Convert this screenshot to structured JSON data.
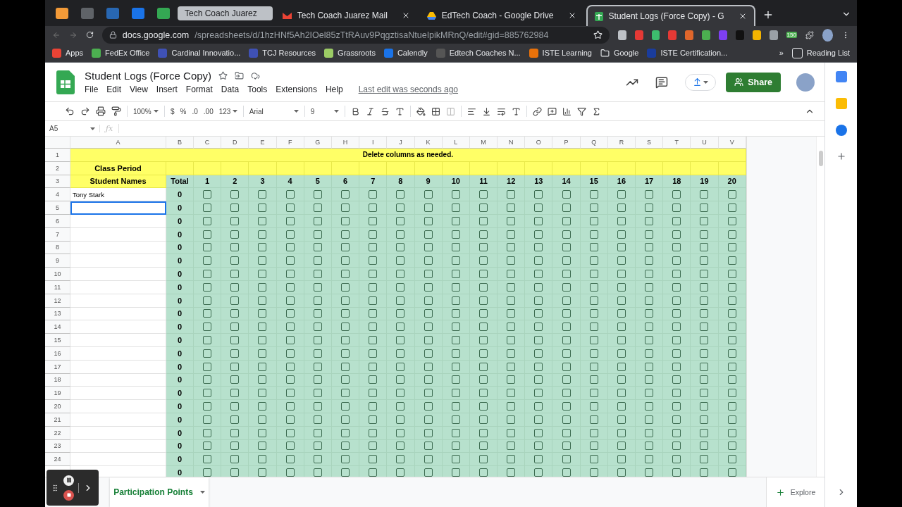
{
  "browser": {
    "tabs": [
      {
        "label": "Tech Coach Juarez",
        "kind": "group",
        "selected": false
      },
      {
        "label": "Tech Coach Juarez Mail",
        "kind": "mail",
        "selected": false
      },
      {
        "label": "EdTech Coach - Google Drive",
        "kind": "drive",
        "selected": false
      },
      {
        "label": "Student Logs (Force Copy) - G",
        "kind": "sheets",
        "selected": true
      }
    ],
    "url_host": "docs.google.com",
    "url_path": "/spreadsheets/d/1hzHNf5Ah2IOel85zTtRAuv9PqgztisaNtueIpikMRnQ/edit#gid=885762984",
    "extension_badge": "150",
    "bookmarks": [
      {
        "label": "Apps",
        "kind": "apps"
      },
      {
        "label": "FedEx Office",
        "kind": "star"
      },
      {
        "label": "Cardinal Innovatio...",
        "kind": "site"
      },
      {
        "label": "TCJ Resources",
        "kind": "site"
      },
      {
        "label": "Grassroots",
        "kind": "leaf"
      },
      {
        "label": "Calendly",
        "kind": "calendly"
      },
      {
        "label": "Edtech Coaches N...",
        "kind": "ring"
      },
      {
        "label": "ISTE Learning",
        "kind": "d2l"
      },
      {
        "label": "Google",
        "kind": "folder"
      },
      {
        "label": "ISTE Certification...",
        "kind": "k"
      }
    ],
    "bookmarks_more": "»",
    "reading_list": "Reading List"
  },
  "doc": {
    "title": "Student Logs (Force Copy)",
    "menu": [
      "File",
      "Edit",
      "View",
      "Insert",
      "Format",
      "Data",
      "Tools",
      "Extensions",
      "Help"
    ],
    "last_edit": "Last edit was seconds ago",
    "share": "Share"
  },
  "toolbar": {
    "zoom": "100%",
    "currency": "$",
    "percent": "%",
    "decimal_decrease": ".0",
    "decimal_increase": ".00",
    "number_format": "123",
    "font": "Arial",
    "font_size": "9"
  },
  "formula_bar": {
    "cell_ref": "A5",
    "fx_label": "ƒx"
  },
  "sheet": {
    "columns": [
      "A",
      "B",
      "C",
      "D",
      "E",
      "F",
      "G",
      "H",
      "I",
      "J",
      "K",
      "L",
      "M",
      "N",
      "O",
      "P",
      "Q",
      "R",
      "S",
      "T",
      "U",
      "V"
    ],
    "header_rows": [
      "1",
      "2",
      "3"
    ],
    "banner": "Delete columns as needed.",
    "class_period": "Class Period",
    "student_names": "Student Names",
    "total_header": "Total",
    "numbers": [
      "1",
      "2",
      "3",
      "4",
      "5",
      "6",
      "7",
      "8",
      "9",
      "10",
      "11",
      "12",
      "13",
      "14",
      "15",
      "16",
      "17",
      "18",
      "19",
      "20"
    ],
    "rows": [
      {
        "number": "4",
        "name": "Tony Stark",
        "total": "0",
        "selected": false,
        "checks": [
          false,
          false,
          false,
          false,
          false,
          false,
          false,
          false,
          false,
          false,
          false,
          false,
          false,
          false,
          false,
          false,
          false,
          false,
          false,
          false
        ]
      },
      {
        "number": "5",
        "total": "0",
        "selected": true,
        "checks": [
          false,
          false,
          false,
          false,
          false,
          false,
          false,
          false,
          false,
          false,
          false,
          false,
          false,
          false,
          false,
          false,
          false,
          false,
          false,
          false
        ]
      },
      {
        "number": "6",
        "total": "0",
        "selected": false,
        "checks": [
          false,
          false,
          false,
          false,
          false,
          false,
          false,
          false,
          false,
          false,
          false,
          false,
          false,
          false,
          false,
          false,
          false,
          false,
          false,
          false
        ]
      },
      {
        "number": "7",
        "total": "0",
        "selected": false,
        "checks": [
          false,
          false,
          false,
          false,
          false,
          false,
          false,
          false,
          false,
          false,
          false,
          false,
          false,
          false,
          false,
          false,
          false,
          false,
          false,
          false
        ]
      },
      {
        "number": "8",
        "total": "0",
        "selected": false,
        "checks": [
          false,
          false,
          false,
          false,
          false,
          false,
          false,
          false,
          false,
          false,
          false,
          false,
          false,
          false,
          false,
          false,
          false,
          false,
          false,
          false
        ]
      },
      {
        "number": "9",
        "total": "0",
        "selected": false,
        "checks": [
          false,
          false,
          false,
          false,
          false,
          false,
          false,
          false,
          false,
          false,
          false,
          false,
          false,
          false,
          false,
          false,
          false,
          false,
          false,
          false
        ]
      },
      {
        "number": "10",
        "total": "0",
        "selected": false,
        "checks": [
          false,
          false,
          false,
          false,
          false,
          false,
          false,
          false,
          false,
          false,
          false,
          false,
          false,
          false,
          false,
          false,
          false,
          false,
          false,
          false
        ]
      },
      {
        "number": "11",
        "total": "0",
        "selected": false,
        "checks": [
          false,
          false,
          false,
          false,
          false,
          false,
          false,
          false,
          false,
          false,
          false,
          false,
          false,
          false,
          false,
          false,
          false,
          false,
          false,
          false
        ]
      },
      {
        "number": "12",
        "total": "0",
        "selected": false,
        "checks": [
          false,
          false,
          false,
          false,
          false,
          false,
          false,
          false,
          false,
          false,
          false,
          false,
          false,
          false,
          false,
          false,
          false,
          false,
          false,
          false
        ]
      },
      {
        "number": "13",
        "total": "0",
        "selected": false,
        "checks": [
          false,
          false,
          false,
          false,
          false,
          false,
          false,
          false,
          false,
          false,
          false,
          false,
          false,
          false,
          false,
          false,
          false,
          false,
          false,
          false
        ]
      },
      {
        "number": "14",
        "total": "0",
        "selected": false,
        "checks": [
          false,
          false,
          false,
          false,
          false,
          false,
          false,
          false,
          false,
          false,
          false,
          false,
          false,
          false,
          false,
          false,
          false,
          false,
          false,
          false
        ]
      },
      {
        "number": "15",
        "total": "0",
        "selected": false,
        "checks": [
          false,
          false,
          false,
          false,
          false,
          false,
          false,
          false,
          false,
          false,
          false,
          false,
          false,
          false,
          false,
          false,
          false,
          false,
          false,
          false
        ]
      },
      {
        "number": "16",
        "total": "0",
        "selected": false,
        "checks": [
          false,
          false,
          false,
          false,
          false,
          false,
          false,
          false,
          false,
          false,
          false,
          false,
          false,
          false,
          false,
          false,
          false,
          false,
          false,
          false
        ]
      },
      {
        "number": "17",
        "total": "0",
        "selected": false,
        "checks": [
          false,
          false,
          false,
          false,
          false,
          false,
          false,
          false,
          false,
          false,
          false,
          false,
          false,
          false,
          false,
          false,
          false,
          false,
          false,
          false
        ]
      },
      {
        "number": "18",
        "total": "0",
        "selected": false,
        "checks": [
          false,
          false,
          false,
          false,
          false,
          false,
          false,
          false,
          false,
          false,
          false,
          false,
          false,
          false,
          false,
          false,
          false,
          false,
          false,
          false
        ]
      },
      {
        "number": "19",
        "total": "0",
        "selected": false,
        "checks": [
          false,
          false,
          false,
          false,
          false,
          false,
          false,
          false,
          false,
          false,
          false,
          false,
          false,
          false,
          false,
          false,
          false,
          false,
          false,
          false
        ]
      },
      {
        "number": "20",
        "total": "0",
        "selected": false,
        "checks": [
          false,
          false,
          false,
          false,
          false,
          false,
          false,
          false,
          false,
          false,
          false,
          false,
          false,
          false,
          false,
          false,
          false,
          false,
          false,
          false
        ]
      },
      {
        "number": "21",
        "total": "0",
        "selected": false,
        "checks": [
          false,
          false,
          false,
          false,
          false,
          false,
          false,
          false,
          false,
          false,
          false,
          false,
          false,
          false,
          false,
          false,
          false,
          false,
          false,
          false
        ]
      },
      {
        "number": "22",
        "total": "0",
        "selected": false,
        "checks": [
          false,
          false,
          false,
          false,
          false,
          false,
          false,
          false,
          false,
          false,
          false,
          false,
          false,
          false,
          false,
          false,
          false,
          false,
          false,
          false
        ]
      },
      {
        "number": "23",
        "total": "0",
        "selected": false,
        "checks": [
          false,
          false,
          false,
          false,
          false,
          false,
          false,
          false,
          false,
          false,
          false,
          false,
          false,
          false,
          false,
          false,
          false,
          false,
          false,
          false
        ]
      },
      {
        "number": "24",
        "total": "0",
        "selected": false,
        "checks": [
          false,
          false,
          false,
          false,
          false,
          false,
          false,
          false,
          false,
          false,
          false,
          false,
          false,
          false,
          false,
          false,
          false,
          false,
          false,
          false
        ]
      },
      {
        "total": "0",
        "selected": false,
        "checks": [
          false,
          false,
          false,
          false,
          false,
          false,
          false,
          false,
          false,
          false,
          false,
          false,
          false,
          false,
          false,
          false,
          false,
          false,
          false,
          false
        ]
      }
    ]
  },
  "sheet_tabs": [
    {
      "label": "Participation Points",
      "selected": true
    }
  ],
  "explore": "Explore"
}
